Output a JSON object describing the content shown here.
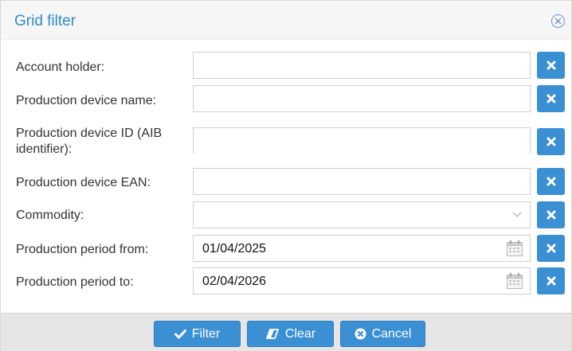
{
  "dialog": {
    "title": "Grid filter",
    "close_icon": "circle-x-icon"
  },
  "fields": {
    "account_holder": {
      "label": "Account holder:",
      "value": ""
    },
    "device_name": {
      "label": "Production device name:",
      "value": ""
    },
    "device_id": {
      "label_line1": "Production device ID (AIB",
      "label_line2": "identifier):",
      "value": ""
    },
    "device_ean": {
      "label": "Production device EAN:",
      "value": ""
    },
    "commodity": {
      "label": "Commodity:",
      "value": ""
    },
    "period_from": {
      "label": "Production period from:",
      "value": "01/04/2025"
    },
    "period_to": {
      "label": "Production period to:",
      "value": "02/04/2026"
    }
  },
  "footer": {
    "filter_label": "Filter",
    "clear_label": "Clear",
    "cancel_label": "Cancel"
  },
  "colors": {
    "accent": "#3b8fd3",
    "title": "#2f8ccc",
    "footer_bg": "#e6e6e6"
  },
  "icons": {
    "clear_field": "x-icon",
    "dropdown": "chevron-down-icon",
    "date": "calendar-icon",
    "filter": "check-icon",
    "clear": "eraser-icon",
    "cancel": "circle-x-icon"
  }
}
